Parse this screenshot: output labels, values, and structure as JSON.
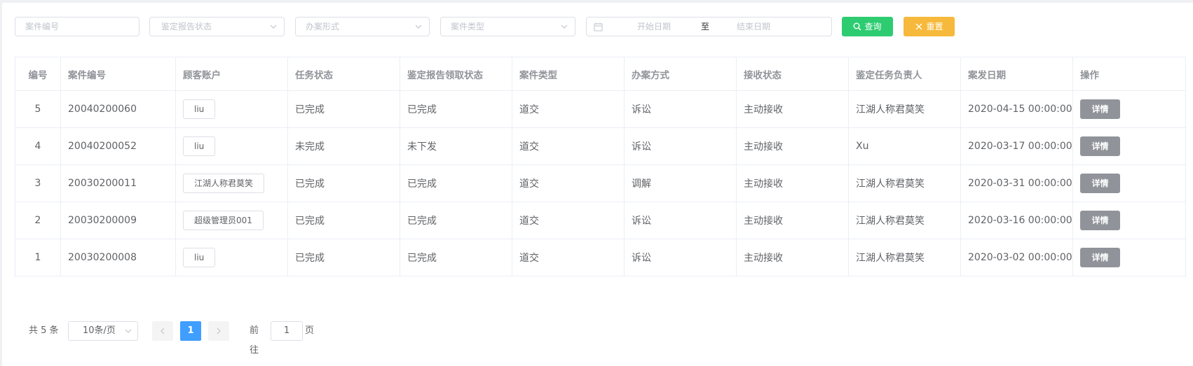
{
  "filters": {
    "case_no_placeholder": "案件编号",
    "report_status_placeholder": "鉴定报告状态",
    "handling_form_placeholder": "办案形式",
    "case_type_placeholder": "案件类型",
    "start_date_placeholder": "开始日期",
    "date_separator": "至",
    "end_date_placeholder": "结束日期",
    "query_label": "查询",
    "reset_label": "重置"
  },
  "colors": {
    "query_button": "#2ecc71",
    "reset_button": "#f6b93b",
    "detail_button": "#909399",
    "active_page": "#409eff"
  },
  "table": {
    "headers": [
      "编号",
      "案件编号",
      "顾客账户",
      "任务状态",
      "鉴定报告领取状态",
      "案件类型",
      "办案方式",
      "接收状态",
      "鉴定任务负责人",
      "案发日期",
      "操作"
    ],
    "rows": [
      {
        "id": "5",
        "case_no": "20040200060",
        "account": "liu",
        "task_status": "已完成",
        "report_status": "已完成",
        "case_type": "道交",
        "method": "诉讼",
        "receive_status": "主动接收",
        "owner": "江湖人称君莫笑",
        "date": "2020-04-15 00:00:00",
        "action": "详情"
      },
      {
        "id": "4",
        "case_no": "20040200052",
        "account": "liu",
        "task_status": "未完成",
        "report_status": "未下发",
        "case_type": "道交",
        "method": "诉讼",
        "receive_status": "主动接收",
        "owner": "Xu",
        "date": "2020-03-17 00:00:00",
        "action": "详情"
      },
      {
        "id": "3",
        "case_no": "20030200011",
        "account": "江湖人称君莫笑",
        "task_status": "已完成",
        "report_status": "已完成",
        "case_type": "道交",
        "method": "调解",
        "receive_status": "主动接收",
        "owner": "江湖人称君莫笑",
        "date": "2020-03-31 00:00:00",
        "action": "详情"
      },
      {
        "id": "2",
        "case_no": "20030200009",
        "account": "超级管理员001",
        "task_status": "已完成",
        "report_status": "已完成",
        "case_type": "道交",
        "method": "诉讼",
        "receive_status": "主动接收",
        "owner": "江湖人称君莫笑",
        "date": "2020-03-16 00:00:00",
        "action": "详情"
      },
      {
        "id": "1",
        "case_no": "20030200008",
        "account": "liu",
        "task_status": "已完成",
        "report_status": "已完成",
        "case_type": "道交",
        "method": "诉讼",
        "receive_status": "主动接收",
        "owner": "江湖人称君莫笑",
        "date": "2020-03-02 00:00:00",
        "action": "详情"
      }
    ]
  },
  "pagination": {
    "total": "共 5 条",
    "page_size": "10条/页",
    "current_page": "1",
    "goto_label": "前往",
    "goto_value": "1",
    "page_suffix": "页"
  }
}
